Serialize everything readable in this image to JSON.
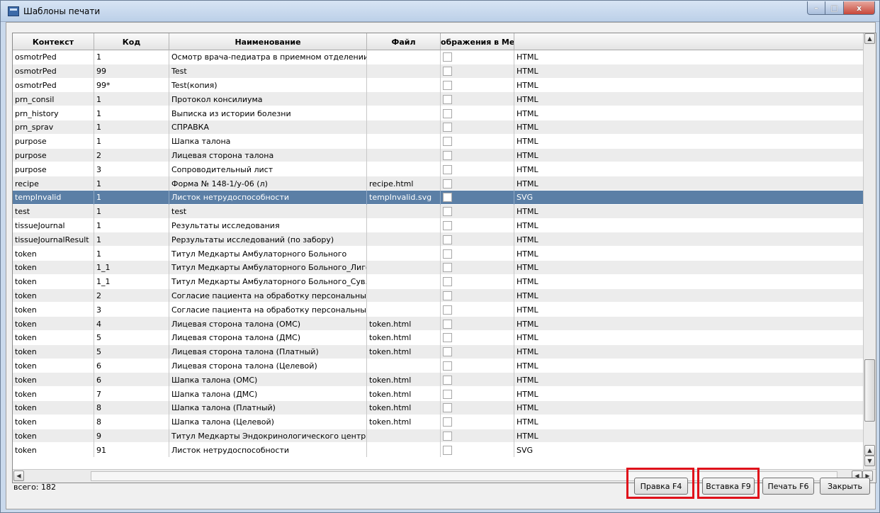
{
  "window": {
    "title": "Шаблоны печати",
    "minimize": "–",
    "maximize": "□",
    "close": "x"
  },
  "table": {
    "columns": [
      "Контекст",
      "Код",
      "Наименование",
      "Файл",
      "ображения в Ме",
      ""
    ],
    "rows": [
      {
        "ctx": "osmotrPed",
        "code": "1",
        "name": "Осмотр врача-педиатра в приемном отделении",
        "file": "",
        "type": "HTML"
      },
      {
        "ctx": "osmotrPed",
        "code": "99",
        "name": "Test",
        "file": "",
        "type": "HTML"
      },
      {
        "ctx": "osmotrPed",
        "code": "99*",
        "name": "Test(копия)",
        "file": "",
        "type": "HTML"
      },
      {
        "ctx": "prn_consil",
        "code": "1",
        "name": "Протокол консилиума",
        "file": "",
        "type": "HTML"
      },
      {
        "ctx": "prn_history",
        "code": "1",
        "name": "Выписка из истории болезни",
        "file": "",
        "type": "HTML"
      },
      {
        "ctx": "prn_sprav",
        "code": "1",
        "name": "СПРАВКА",
        "file": "",
        "type": "HTML"
      },
      {
        "ctx": "purpose",
        "code": "1",
        "name": "Шапка талона",
        "file": "",
        "type": "HTML"
      },
      {
        "ctx": "purpose",
        "code": "2",
        "name": "Лицевая сторона талона",
        "file": "",
        "type": "HTML"
      },
      {
        "ctx": "purpose",
        "code": "3",
        "name": "Сопроводительный лист",
        "file": "",
        "type": "HTML"
      },
      {
        "ctx": "recipe",
        "code": "1",
        "name": "Форма № 148-1/у-06 (л)",
        "file": "recipe.html",
        "type": "HTML"
      },
      {
        "ctx": "tempInvalid",
        "code": "1",
        "name": "Листок нетрудоспособности",
        "file": "tempInvalid.svg",
        "type": "SVG",
        "selected": true
      },
      {
        "ctx": "test",
        "code": "1",
        "name": "test",
        "file": "",
        "type": "HTML"
      },
      {
        "ctx": "tissueJournal",
        "code": "1",
        "name": "Результаты исследования",
        "file": "",
        "type": "HTML"
      },
      {
        "ctx": "tissueJournalResult",
        "code": "1",
        "name": "Рерзультаты исследований (по забору)",
        "file": "",
        "type": "HTML"
      },
      {
        "ctx": "token",
        "code": "1",
        "name": "Титул Медкарты Амбулаторного Больного",
        "file": "",
        "type": "HTML"
      },
      {
        "ctx": "token",
        "code": "1_1",
        "name": "Титул Медкарты Амбулаторного Больного_Лиго...",
        "file": "",
        "type": "HTML"
      },
      {
        "ctx": "token",
        "code": "1_1",
        "name": "Титул Медкарты Амбулаторного Больного_Сув...",
        "file": "",
        "type": "HTML"
      },
      {
        "ctx": "token",
        "code": "2",
        "name": "Согласие пациента на обработку персональных...",
        "file": "",
        "type": "HTML"
      },
      {
        "ctx": "token",
        "code": "3",
        "name": "Согласие пациента на обработку персональных...",
        "file": "",
        "type": "HTML"
      },
      {
        "ctx": "token",
        "code": "4",
        "name": "Лицевая сторона талона (ОМС)",
        "file": "token.html",
        "type": "HTML"
      },
      {
        "ctx": "token",
        "code": "5",
        "name": "Лицевая сторона талона (ДМС)",
        "file": "token.html",
        "type": "HTML"
      },
      {
        "ctx": "token",
        "code": "5",
        "name": "Лицевая сторона талона (Платный)",
        "file": "token.html",
        "type": "HTML"
      },
      {
        "ctx": "token",
        "code": "6",
        "name": "Лицевая сторона талона (Целевой)",
        "file": "",
        "type": "HTML"
      },
      {
        "ctx": "token",
        "code": "6",
        "name": "Шапка талона (ОМС)",
        "file": "token.html",
        "type": "HTML"
      },
      {
        "ctx": "token",
        "code": "7",
        "name": "Шапка талона (ДМС)",
        "file": "token.html",
        "type": "HTML"
      },
      {
        "ctx": "token",
        "code": "8",
        "name": "Шапка талона (Платный)",
        "file": "token.html",
        "type": "HTML"
      },
      {
        "ctx": "token",
        "code": "8",
        "name": "Шапка талона (Целевой)",
        "file": "token.html",
        "type": "HTML"
      },
      {
        "ctx": "token",
        "code": "9",
        "name": "Титул Медкарты Эндокринологического центра",
        "file": "",
        "type": "HTML"
      },
      {
        "ctx": "token",
        "code": "91",
        "name": "Листок нетрудоспособности",
        "file": "",
        "type": "SVG"
      }
    ]
  },
  "scroll": {
    "up": "▲",
    "down": "▼",
    "left": "◀",
    "right": "▶"
  },
  "footer": {
    "total": "всего: 182",
    "edit_label": "Правка F4",
    "insert_label": "Вставка F9",
    "print_label": "Печать F6",
    "close_label": "Закрыть"
  },
  "colors": {
    "selection": "#5b7fa6",
    "highlight": "#e0101a"
  }
}
